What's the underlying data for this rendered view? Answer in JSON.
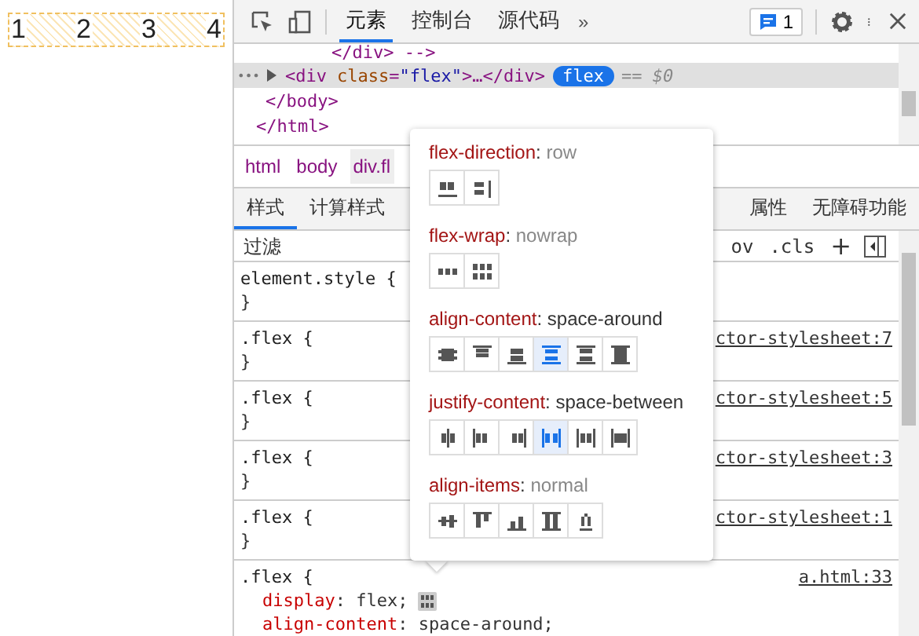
{
  "demo": {
    "items": [
      "1",
      "2",
      "3",
      "4"
    ]
  },
  "toolbar": {
    "tabs": [
      {
        "label": "元素",
        "selected": true
      },
      {
        "label": "控制台",
        "selected": false
      },
      {
        "label": "源代码",
        "selected": false
      }
    ],
    "more": "»",
    "issues": "1"
  },
  "dom": {
    "lines": [
      {
        "kind": "comment",
        "text": "</div> -->"
      },
      {
        "kind": "selected",
        "dots": "•••",
        "open": "<div",
        "attr": "class",
        "eq": "=",
        "value": "\"flex\"",
        "rest": ">…</div>",
        "badge": "flex",
        "suffix": "== $0"
      },
      {
        "kind": "close",
        "text": "</body>"
      },
      {
        "kind": "close",
        "text": "</html>"
      }
    ]
  },
  "breadcrumbs": [
    {
      "label": "html",
      "selected": false
    },
    {
      "label": "body",
      "selected": false
    },
    {
      "label": "div.fl",
      "selected": true
    }
  ],
  "panel_tabs": [
    {
      "label": "样式",
      "selected": true
    },
    {
      "label": "计算样式",
      "selected": false
    },
    {
      "label": "属性",
      "selected": false
    },
    {
      "label": "无障碍功能",
      "selected": false
    }
  ],
  "filter": {
    "placeholder": "过滤",
    "hov": "ov",
    "cls": ".cls",
    "add": "+"
  },
  "rules": [
    {
      "selector": "element.style {",
      "close": "}"
    },
    {
      "selector": ".flex {",
      "close": "}",
      "source": "ctor-stylesheet:7"
    },
    {
      "selector": ".flex {",
      "close": "}",
      "source": "ctor-stylesheet:5"
    },
    {
      "selector": ".flex {",
      "close": "}",
      "source": "ctor-stylesheet:3"
    },
    {
      "selector": ".flex {",
      "close": "}",
      "source": "ctor-stylesheet:1"
    },
    {
      "selector": ".flex {",
      "source": "a.html:33",
      "declarations": [
        {
          "property": "display",
          "colon": ":",
          "value": "flex;",
          "editor": true
        },
        {
          "property": "align-content",
          "colon": ":",
          "value": "space-around;",
          "editor": false
        }
      ]
    }
  ],
  "flex_editor": {
    "sections": [
      {
        "property": "flex-direction",
        "colon": ":",
        "value": "row",
        "set": false,
        "buttons": [
          {
            "selected": false
          },
          {
            "selected": false
          }
        ]
      },
      {
        "property": "flex-wrap",
        "colon": ":",
        "value": "nowrap",
        "set": false,
        "buttons": [
          {
            "selected": false
          },
          {
            "selected": false
          }
        ]
      },
      {
        "property": "align-content",
        "colon": ":",
        "value": "space-around",
        "set": true,
        "buttons": [
          {
            "selected": false
          },
          {
            "selected": false
          },
          {
            "selected": false
          },
          {
            "selected": true
          },
          {
            "selected": false
          },
          {
            "selected": false
          }
        ]
      },
      {
        "property": "justify-content",
        "colon": ":",
        "value": "space-between",
        "set": true,
        "buttons": [
          {
            "selected": false
          },
          {
            "selected": false
          },
          {
            "selected": false
          },
          {
            "selected": true
          },
          {
            "selected": false
          },
          {
            "selected": false
          }
        ]
      },
      {
        "property": "align-items",
        "colon": ":",
        "value": "normal",
        "set": false,
        "buttons": [
          {
            "selected": false
          },
          {
            "selected": false
          },
          {
            "selected": false
          },
          {
            "selected": false
          },
          {
            "selected": false
          }
        ]
      }
    ]
  }
}
